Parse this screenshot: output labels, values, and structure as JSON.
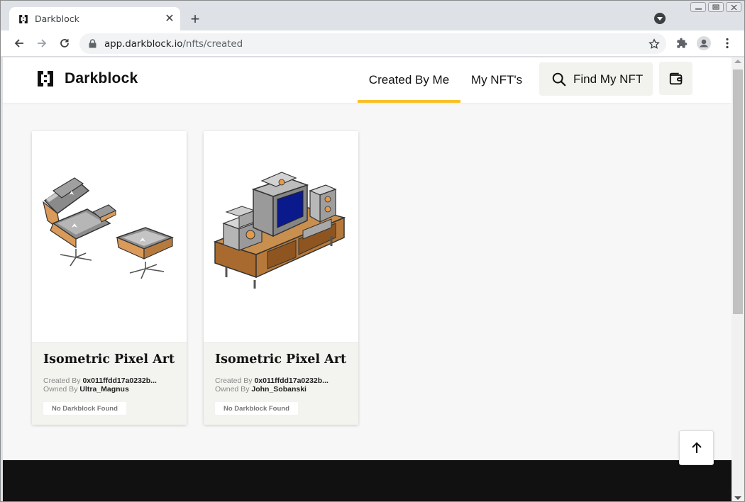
{
  "browser": {
    "tab_title": "Darkblock",
    "url_host": "app.darkblock.io",
    "url_path": "/nfts/created",
    "window_controls": [
      "minimize",
      "restore",
      "close"
    ]
  },
  "app": {
    "brand_name": "Darkblock",
    "nav": {
      "created_by_me": "Created By Me",
      "my_nfts": "My NFT's",
      "find_my_nft": "Find My NFT"
    },
    "accent_color": "#f8c12b"
  },
  "cards": [
    {
      "title": "Isometric Pixel Art ...",
      "created_by_label": "Created By",
      "created_by": "0x011ffdd17a0232b...",
      "owned_by_label": "Owned By",
      "owned_by": "Ultra_Magnus",
      "badge": "No Darkblock Found",
      "image": "lounge-chair-and-ottoman"
    },
    {
      "title": "Isometric Pixel Art ...",
      "created_by_label": "Created By",
      "created_by": "0x011ffdd17a0232b...",
      "owned_by_label": "Owned By",
      "owned_by": "John_Sobanski",
      "badge": "No Darkblock Found",
      "image": "tv-stereo-cabinet"
    }
  ]
}
